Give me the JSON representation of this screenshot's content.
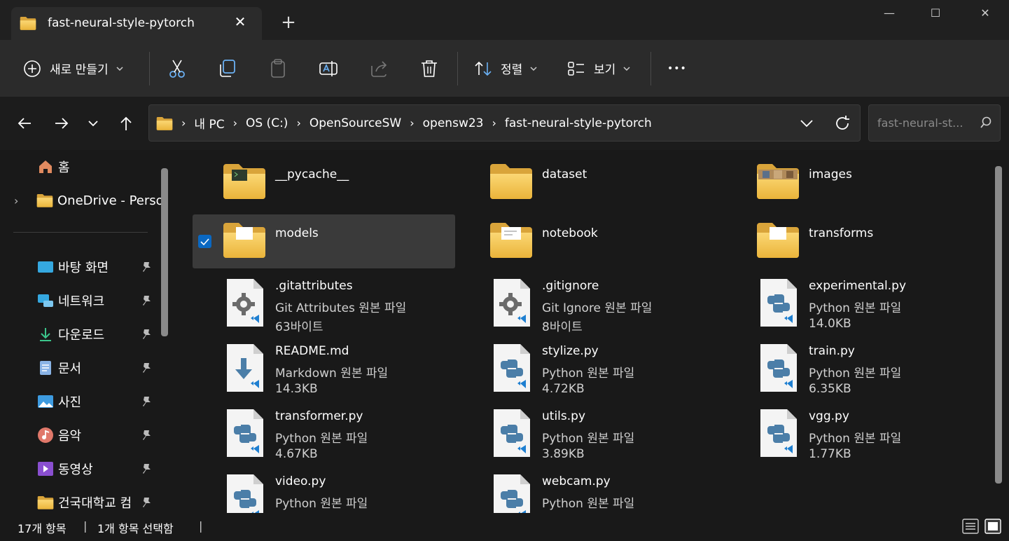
{
  "window": {
    "tab_title": "fast-neural-style-pytorch",
    "close_tab": "✕",
    "new_tab": "+",
    "minimize": "—",
    "maximize": "☐",
    "close": "✕"
  },
  "toolbar": {
    "new_label": "새로 만들기",
    "sort_label": "정렬",
    "view_label": "보기",
    "more_label": "•••"
  },
  "address": {
    "crumbs": [
      "내 PC",
      "OS (C:)",
      "OpenSourceSW",
      "opensw23",
      "fast-neural-style-pytorch"
    ],
    "search_placeholder": "fast-neural-st..."
  },
  "sidebar": {
    "items": [
      {
        "label": "홈",
        "icon": "home-icon"
      },
      {
        "label": "OneDrive - Perso",
        "icon": "folder-icon"
      },
      {
        "label": "바탕 화면",
        "icon": "desktop-icon",
        "pinned": true
      },
      {
        "label": "네트워크",
        "icon": "network-icon",
        "pinned": true
      },
      {
        "label": "다운로드",
        "icon": "download-icon",
        "pinned": true
      },
      {
        "label": "문서",
        "icon": "document-icon",
        "pinned": true
      },
      {
        "label": "사진",
        "icon": "pictures-icon",
        "pinned": true
      },
      {
        "label": "음악",
        "icon": "music-icon",
        "pinned": true
      },
      {
        "label": "동영상",
        "icon": "videos-icon",
        "pinned": true
      },
      {
        "label": "건국대학교 컴",
        "icon": "folder-icon",
        "pinned": true
      }
    ]
  },
  "files": {
    "folders": [
      {
        "name": "__pycache__",
        "icon": "pycache-folder-icon"
      },
      {
        "name": "dataset",
        "icon": "folder-icon"
      },
      {
        "name": "images",
        "icon": "images-folder-icon"
      },
      {
        "name": "models",
        "icon": "folder-with-files-icon",
        "selected": true
      },
      {
        "name": "notebook",
        "icon": "folder-with-files-icon"
      },
      {
        "name": "transforms",
        "icon": "folder-with-files-icon"
      }
    ],
    "files": [
      {
        "name": ".gitattributes",
        "type": "Git Attributes 원본 파일",
        "size": "63바이트",
        "icon": "gear-file-icon"
      },
      {
        "name": ".gitignore",
        "type": "Git Ignore 원본 파일",
        "size": "8바이트",
        "icon": "gear-file-icon"
      },
      {
        "name": "experimental.py",
        "type": "Python 원본 파일",
        "size": "14.0KB",
        "icon": "python-file-icon"
      },
      {
        "name": "README.md",
        "type": "Markdown 원본 파일",
        "size": "14.3KB",
        "icon": "markdown-file-icon"
      },
      {
        "name": "stylize.py",
        "type": "Python 원본 파일",
        "size": "4.72KB",
        "icon": "python-file-icon"
      },
      {
        "name": "train.py",
        "type": "Python 원본 파일",
        "size": "6.35KB",
        "icon": "python-file-icon"
      },
      {
        "name": "transformer.py",
        "type": "Python 원본 파일",
        "size": "4.67KB",
        "icon": "python-file-icon"
      },
      {
        "name": "utils.py",
        "type": "Python 원본 파일",
        "size": "3.89KB",
        "icon": "python-file-icon"
      },
      {
        "name": "vgg.py",
        "type": "Python 원본 파일",
        "size": "1.77KB",
        "icon": "python-file-icon"
      },
      {
        "name": "video.py",
        "type": "Python 원본 파일",
        "size": "",
        "icon": "python-file-icon"
      },
      {
        "name": "webcam.py",
        "type": "Python 원본 파일",
        "size": "",
        "icon": "python-file-icon"
      }
    ]
  },
  "status": {
    "count": "17개 항목",
    "selected": "1개 항목 선택함"
  },
  "colors": {
    "accent": "#0a68c2",
    "folder": "#f2c14e",
    "python": "#4b7ea8"
  }
}
